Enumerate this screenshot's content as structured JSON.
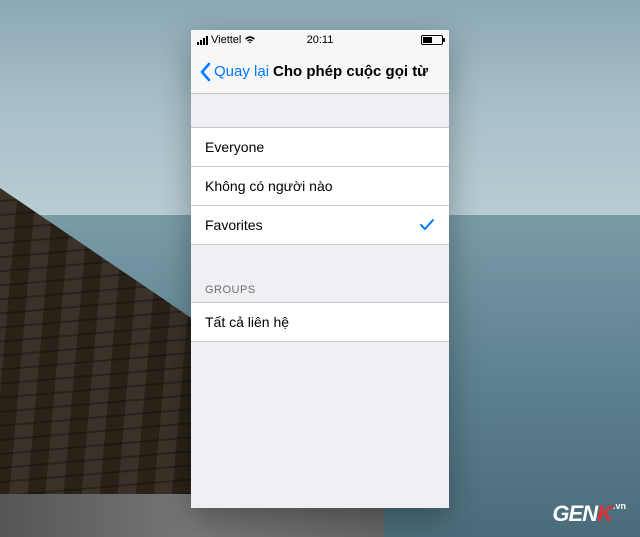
{
  "status_bar": {
    "carrier": "Viettel",
    "time": "20:11"
  },
  "nav": {
    "back_label": "Quay lại",
    "title": "Cho phép cuộc gọi từ"
  },
  "options": [
    {
      "label": "Everyone",
      "selected": false
    },
    {
      "label": "Không có người nào",
      "selected": false
    },
    {
      "label": "Favorites",
      "selected": true
    }
  ],
  "groups_header": "GROUPS",
  "groups": [
    {
      "label": "Tất cả liên hệ"
    }
  ],
  "watermark": {
    "gen": "GEN",
    "k": "K",
    "vn": ".vn"
  }
}
